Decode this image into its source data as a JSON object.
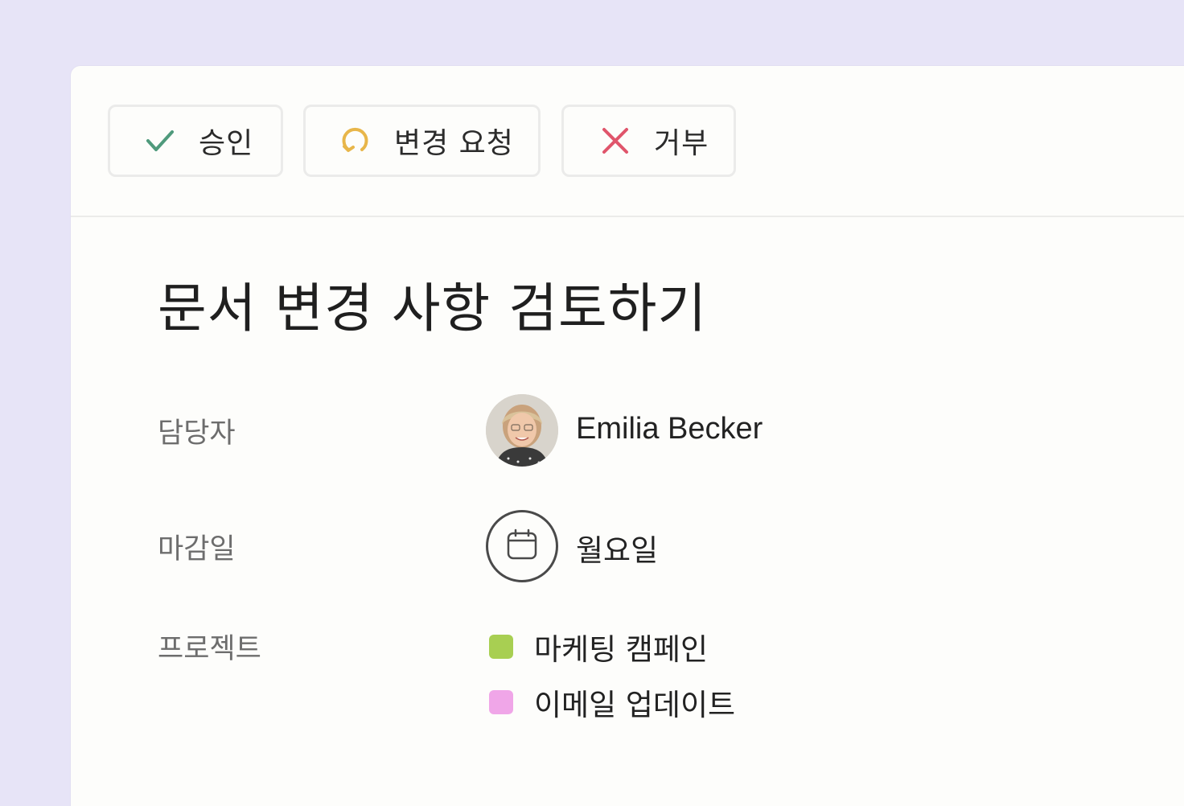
{
  "toolbar": {
    "approve_label": "승인",
    "request_changes_label": "변경 요청",
    "reject_label": "거부"
  },
  "task": {
    "title": "문서 변경 사항 검토하기"
  },
  "fields": {
    "assignee_label": "담당자",
    "assignee_name": "Emilia Becker",
    "due_label": "마감일",
    "due_value": "월요일",
    "project_label": "프로젝트",
    "projects": [
      {
        "name": "마케팅 캠페인",
        "color": "#a8cf52"
      },
      {
        "name": "이메일 업데이트",
        "color": "#f0a6e8"
      }
    ]
  },
  "icons": {
    "approve": "check-icon",
    "request_changes": "refresh-icon",
    "reject": "x-icon",
    "due": "calendar-icon"
  },
  "colors": {
    "approve": "#4f9a7c",
    "request_changes": "#e8b64a",
    "reject": "#e0556b",
    "background": "#e7e4f7"
  }
}
